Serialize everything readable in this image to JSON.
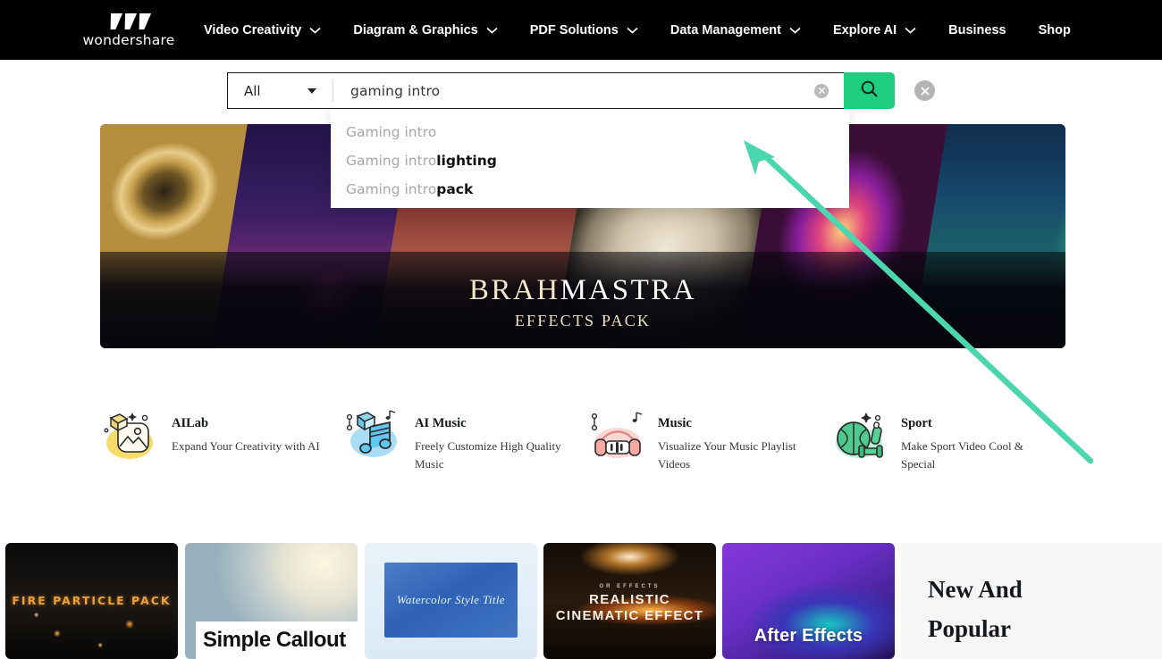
{
  "brand": {
    "name": "wondershare",
    "logo_icon": "wondershare-w-logo"
  },
  "nav": {
    "items": [
      {
        "label": "Video Creativity",
        "has_dropdown": true
      },
      {
        "label": "Diagram & Graphics",
        "has_dropdown": true
      },
      {
        "label": "PDF Solutions",
        "has_dropdown": true
      },
      {
        "label": "Data Management",
        "has_dropdown": true
      },
      {
        "label": "Explore AI",
        "has_dropdown": true
      },
      {
        "label": "Business",
        "has_dropdown": false
      },
      {
        "label": "Shop",
        "has_dropdown": false
      }
    ]
  },
  "search": {
    "category_label": "All",
    "category_caret_icon": "caret-down-icon",
    "value": "gaming intro",
    "placeholder": "Search",
    "inline_clear_icon": "clear-circle-icon",
    "submit_icon": "search-icon",
    "close_icon": "close-circle-icon",
    "button_color": "#1ECD7D",
    "suggestions": [
      {
        "prefix": "Gaming intro",
        "bold": ""
      },
      {
        "prefix": "Gaming intro",
        "bold": "lighting"
      },
      {
        "prefix": "Gaming intro",
        "bold": "pack"
      }
    ]
  },
  "hero": {
    "title_part1": "BRAH",
    "title_part2": "MASTRA",
    "subtitle": "EFFECTS PACK"
  },
  "categories": [
    {
      "name": "AILab",
      "desc": "Expand Your Creativity with AI",
      "icon": "ai-image-icon",
      "color": "#F8DC6B"
    },
    {
      "name": "AI Music",
      "desc": "Freely Customize High Quality Music",
      "icon": "ai-music-note-icon",
      "color": "#A9DDF5"
    },
    {
      "name": "Music",
      "desc": "Visualize Your Music Playlist Videos",
      "icon": "headphones-icon",
      "color": "#F8A8A0"
    },
    {
      "name": "Sport",
      "desc": "Make Sport Video Cool & Special",
      "icon": "sport-ball-icon",
      "color": "#63D6A0"
    }
  ],
  "thumbnails": [
    {
      "label": "FIRE PARTICLE PACK"
    },
    {
      "label": "Simple Callout"
    },
    {
      "label": "Watercolor Style Title"
    },
    {
      "label_small": "OR EFFECTS",
      "label_line1": "REALISTIC",
      "label_line2": "CINEMATIC EFFECT"
    },
    {
      "label": "After Effects"
    }
  ],
  "new_and_popular": {
    "line1": "New And",
    "line2": "Popular"
  },
  "annotation": {
    "arrow_color": "#4BD6B0",
    "arrow_name": "pointer-arrow"
  }
}
